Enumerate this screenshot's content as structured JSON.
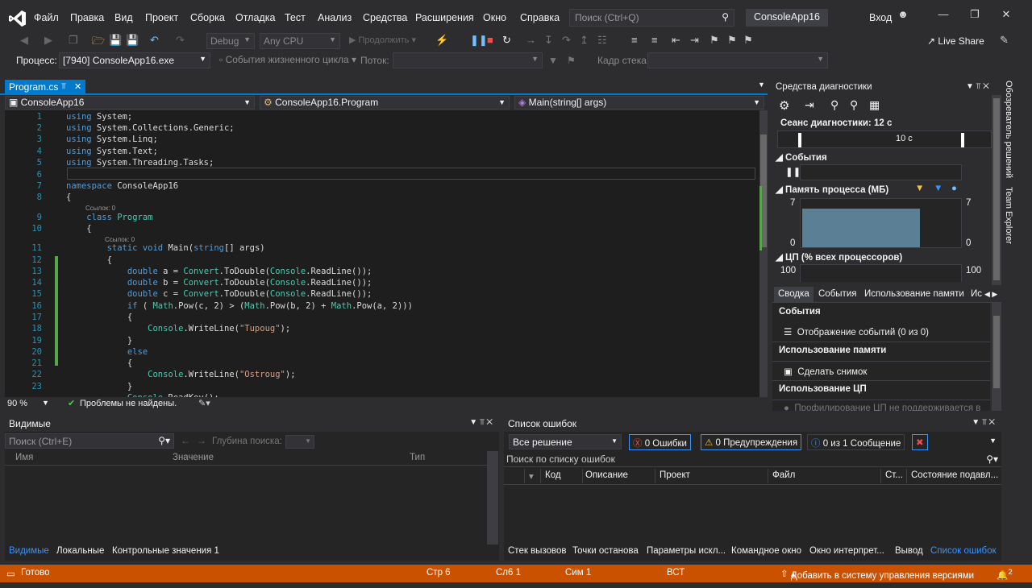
{
  "menu": [
    "Файл",
    "Правка",
    "Вид",
    "Проект",
    "Сборка",
    "Отладка",
    "Тест",
    "Анализ",
    "Средства",
    "Расширения",
    "Окно",
    "Справка"
  ],
  "search": {
    "placeholder": "Поиск (Ctrl+Q)"
  },
  "app_name": "ConsoleApp16",
  "login": "Вход",
  "toolbar": {
    "config": "Debug",
    "platform": "Any CPU",
    "continue": "Продолжить",
    "live_share": "Live Share"
  },
  "process_bar": {
    "process_label": "Процесс:",
    "process_value": "[7940] ConsoleApp16.exe",
    "lifecycle": "События жизненного цикла",
    "thread_label": "Поток:",
    "stackframe_label": "Кадр стека:"
  },
  "editor": {
    "tab": "Program.cs",
    "nav": [
      "ConsoleApp16",
      "ConsoleApp16.Program",
      "Main(string[] args)"
    ],
    "ref_label": "Ссылок: 0",
    "zoom": "90 %",
    "issues": "Проблемы не найдены.",
    "lines": [
      "1",
      "2",
      "3",
      "4",
      "5",
      "6",
      "7",
      "8",
      "9",
      "10",
      "11",
      "12",
      "13",
      "14",
      "15",
      "16",
      "17",
      "18",
      "19",
      "20",
      "21",
      "22",
      "23"
    ]
  },
  "diagnostics": {
    "title": "Средства диагностики",
    "session": "Сеанс диагностики: 12 с",
    "timeline_tick": "10 с",
    "events": "События",
    "memory": "Память процесса (МБ)",
    "mem_max": "7",
    "mem_min": "0",
    "cpu": "ЦП (% всех процессоров)",
    "cpu_max": "100",
    "tabs": [
      "Сводка",
      "События",
      "Использование памяти",
      "Ис"
    ],
    "sec_events": "События",
    "show_events": "Отображение событий (0 из 0)",
    "sec_memory": "Использование памяти",
    "snapshot": "Сделать снимок",
    "sec_cpu": "Использование ЦП",
    "cpu_note": "Профилирование ЦП не поддерживается в"
  },
  "side_tabs": [
    "Обозреватель решений",
    "Team Explorer"
  ],
  "watch": {
    "title": "Видимые",
    "search": "Поиск (Ctrl+E)",
    "depth": "Глубина поиска:",
    "cols": [
      "Имя",
      "Значение",
      "Тип"
    ],
    "tabs": [
      "Видимые",
      "Локальные",
      "Контрольные значения 1"
    ]
  },
  "errors": {
    "title": "Список ошибок",
    "scope": "Все решение",
    "errors_btn": "0 Ошибки",
    "warnings_btn": "0 Предупреждения",
    "messages_btn": "0 из 1 Сообщение",
    "search": "Поиск по списку ошибок",
    "cols": [
      "Код",
      "Описание",
      "Проект",
      "Файл",
      "Ст...",
      "Состояние подавл..."
    ],
    "tabs": [
      "Стек вызовов",
      "Точки останова",
      "Параметры искл...",
      "Командное окно",
      "Окно интерпрет...",
      "Вывод",
      "Список ошибок"
    ]
  },
  "status": {
    "ready": "Готово",
    "line": "Стр 6",
    "col": "Сл6 1",
    "ch": "Сим 1",
    "mode": "ВСТ",
    "vcs": "Добавить в систему управления версиями",
    "notif": "2"
  },
  "memory_fill": 0.8,
  "colors": {
    "accent": "#007acc",
    "status": "#ca5100"
  }
}
